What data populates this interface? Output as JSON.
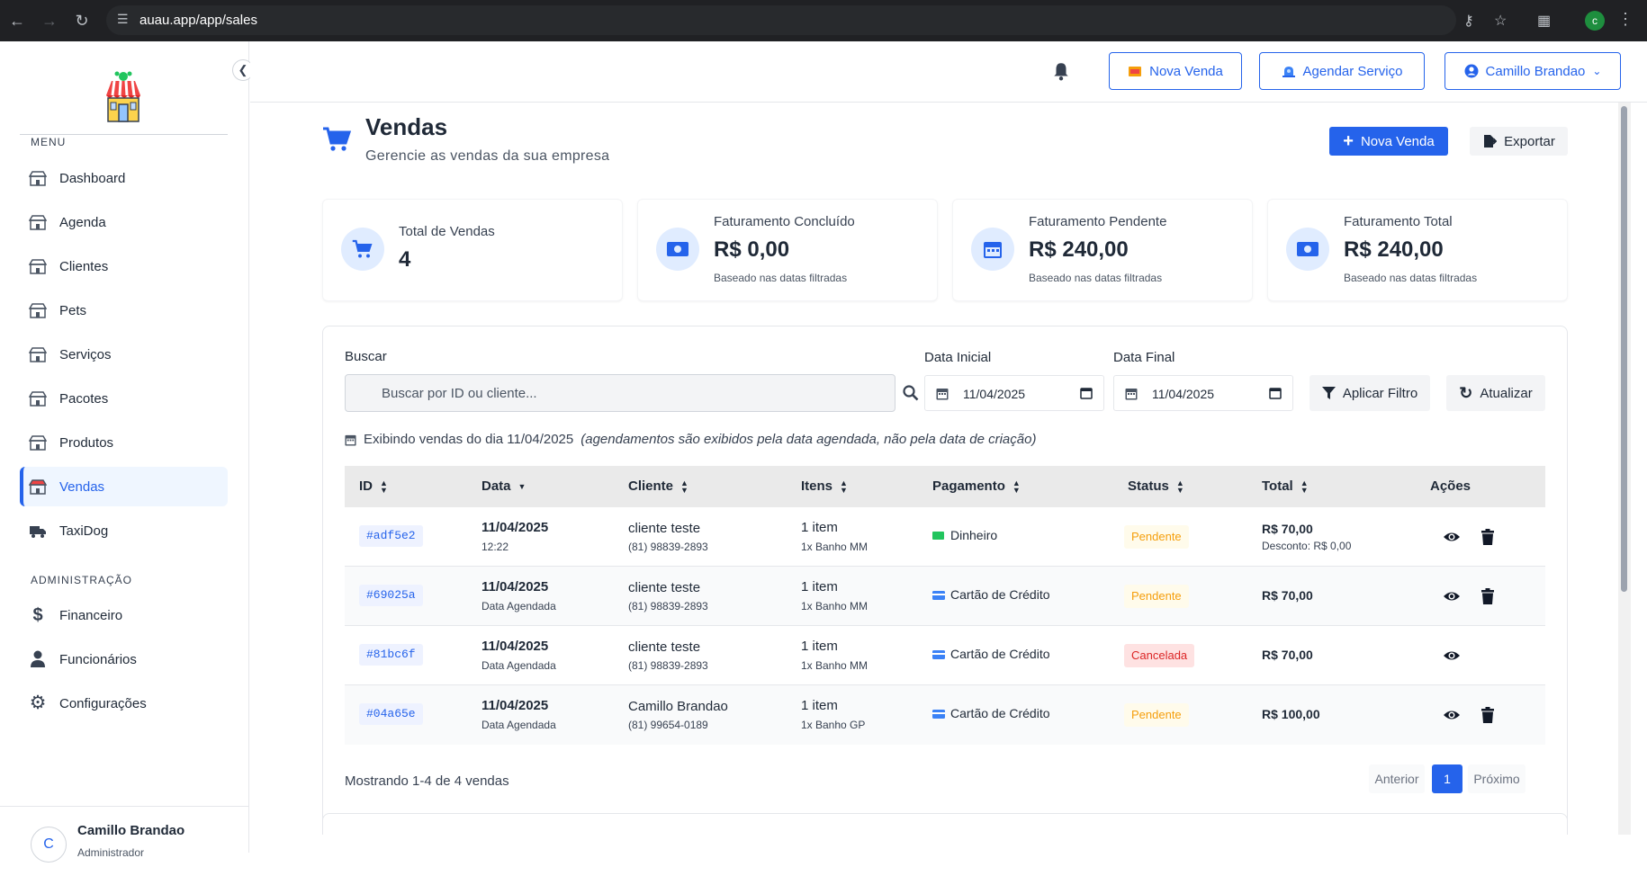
{
  "browser": {
    "url": "auau.app/app/sales"
  },
  "sidebar": {
    "menu_label": "MENU",
    "items": [
      {
        "label": "Dashboard",
        "icon": "store-icon"
      },
      {
        "label": "Agenda",
        "icon": "store-icon"
      },
      {
        "label": "Clientes",
        "icon": "store-icon"
      },
      {
        "label": "Pets",
        "icon": "store-icon"
      },
      {
        "label": "Serviços",
        "icon": "store-icon"
      },
      {
        "label": "Pacotes",
        "icon": "store-icon"
      },
      {
        "label": "Produtos",
        "icon": "store-icon"
      },
      {
        "label": "Vendas",
        "icon": "store-icon",
        "active": true
      },
      {
        "label": "TaxiDog",
        "icon": "truck-icon"
      }
    ],
    "admin_label": "ADMINISTRAÇÃO",
    "admin_items": [
      {
        "label": "Financeiro",
        "icon": "dollar-icon"
      },
      {
        "label": "Funcionários",
        "icon": "user-tie-icon"
      },
      {
        "label": "Configurações",
        "icon": "gear-icon"
      }
    ],
    "user": {
      "initial": "C",
      "name": "Camillo Brandao",
      "role": "Administrador"
    }
  },
  "topbar": {
    "nova_venda": "Nova Venda",
    "agendar_servico": "Agendar Serviço",
    "user_menu": "Camillo Brandao"
  },
  "page": {
    "title": "Vendas",
    "subtitle": "Gerencie as vendas da sua empresa",
    "new_sale_button": "Nova Venda",
    "export_button": "Exportar"
  },
  "stats": [
    {
      "label": "Total de Vendas",
      "value": "4",
      "hint": ""
    },
    {
      "label": "Faturamento Concluído",
      "value": "R$ 0,00",
      "hint": "Baseado nas datas filtradas"
    },
    {
      "label": "Faturamento Pendente",
      "value": "R$ 240,00",
      "hint": "Baseado nas datas filtradas"
    },
    {
      "label": "Faturamento Total",
      "value": "R$ 240,00",
      "hint": "Baseado nas datas filtradas"
    }
  ],
  "filters": {
    "search_label": "Buscar",
    "search_placeholder": "Buscar por ID ou cliente...",
    "start_label": "Data Inicial",
    "start_value": "11/04/2025",
    "end_label": "Data Final",
    "end_value": "11/04/2025",
    "apply_button": "Aplicar Filtro",
    "refresh_button": "Atualizar"
  },
  "info": {
    "text": "Exibindo vendas do dia 11/04/2025",
    "note": "(agendamentos são exibidos pela data agendada, não pela data de criação)"
  },
  "table": {
    "columns": [
      "ID",
      "Data",
      "Cliente",
      "Itens",
      "Pagamento",
      "Status",
      "Total",
      "Ações"
    ],
    "rows": [
      {
        "id": "#adf5e2",
        "date": "11/04/2025",
        "date_sub": "12:22",
        "client": "cliente teste",
        "phone": "(81) 98839-2893",
        "items": "1 item",
        "items_sub": "1x Banho MM",
        "payment": "Dinheiro",
        "payment_icon": "cash-icon",
        "status": "Pendente",
        "status_kind": "pending",
        "total": "R$ 70,00",
        "total_sub": "Desconto: R$ 0,00",
        "can_delete": true
      },
      {
        "id": "#69025a",
        "date": "11/04/2025",
        "date_sub": "Data Agendada",
        "client": "cliente teste",
        "phone": "(81) 98839-2893",
        "items": "1 item",
        "items_sub": "1x Banho MM",
        "payment": "Cartão de Crédito",
        "payment_icon": "credit-card-icon",
        "status": "Pendente",
        "status_kind": "pending",
        "total": "R$ 70,00",
        "total_sub": "",
        "can_delete": true
      },
      {
        "id": "#81bc6f",
        "date": "11/04/2025",
        "date_sub": "Data Agendada",
        "client": "cliente teste",
        "phone": "(81) 98839-2893",
        "items": "1 item",
        "items_sub": "1x Banho MM",
        "payment": "Cartão de Crédito",
        "payment_icon": "credit-card-icon",
        "status": "Cancelada",
        "status_kind": "cancelled",
        "total": "R$ 70,00",
        "total_sub": "",
        "can_delete": false
      },
      {
        "id": "#04a65e",
        "date": "11/04/2025",
        "date_sub": "Data Agendada",
        "client": "Camillo Brandao",
        "phone": "(81) 99654-0189",
        "items": "1 item",
        "items_sub": "1x Banho GP",
        "payment": "Cartão de Crédito",
        "payment_icon": "credit-card-icon",
        "status": "Pendente",
        "status_kind": "pending",
        "total": "R$ 100,00",
        "total_sub": "",
        "can_delete": true
      }
    ]
  },
  "pagination": {
    "summary": "Mostrando 1-4 de 4 vendas",
    "prev": "Anterior",
    "current": "1",
    "next": "Próximo"
  },
  "colors": {
    "accent": "#2563eb",
    "pending": "#f59e0b",
    "cancelled": "#dc2626"
  }
}
